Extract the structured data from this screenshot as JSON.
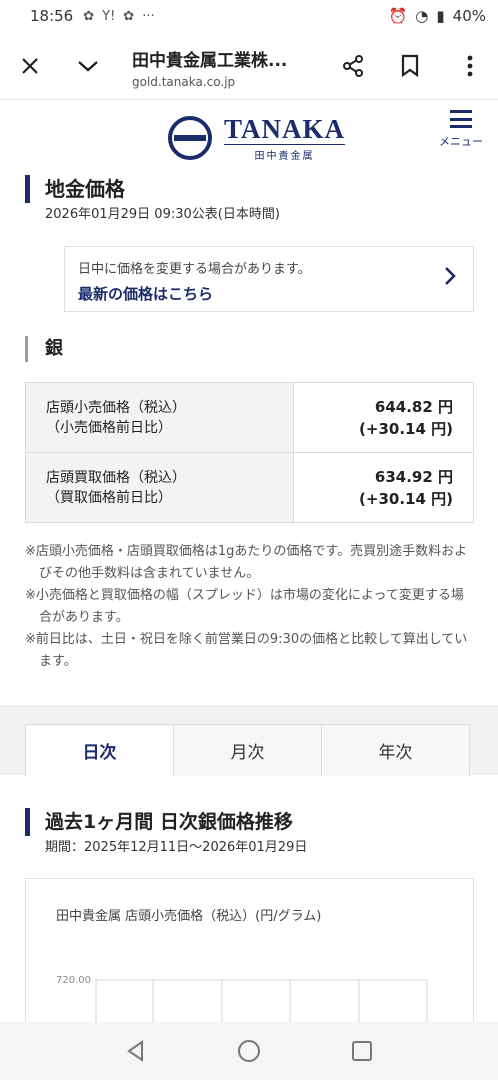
{
  "status": {
    "time": "18:56",
    "battery": "40%"
  },
  "browser": {
    "title": "田中貴金属工業株...",
    "url": "gold.tanaka.co.jp"
  },
  "site": {
    "logo_en": "TANAKA",
    "logo_jp": "田中貴金属",
    "menu_label": "メニュー"
  },
  "page": {
    "title": "地金価格",
    "published": "2026年01月29日 09:30公表(日本時間)",
    "notice": {
      "text": "日中に価格を変更する場合があります。",
      "link": "最新の価格はこちら"
    },
    "metal": "銀",
    "rows": [
      {
        "label1": "店頭小売価格（税込）",
        "label2": "（小売価格前日比）",
        "value1": "644.82 円",
        "value2": "(+30.14 円)"
      },
      {
        "label1": "店頭買取価格（税込）",
        "label2": "（買取価格前日比）",
        "value1": "634.92 円",
        "value2": "(+30.14 円)"
      }
    ],
    "notes": [
      "※店頭小売価格・店頭買取価格は1gあたりの価格です。売買別途手数料およびその他手数料は含まれていません。",
      "※小売価格と買取価格の幅（スプレッド）は市場の変化によって変更する場合があります。",
      "※前日比は、土日・祝日を除く前営業日の9:30の価格と比較して算出しています。"
    ]
  },
  "tabs": [
    "日次",
    "月次",
    "年次"
  ],
  "chart": {
    "title": "過去1ヶ月間 日次銀価格推移",
    "period": "期間：2025年12月11日〜2026年01月29日",
    "series_label": "田中貴金属 店頭小売価格（税込）(円/グラム)",
    "y_tick": "720.00"
  },
  "colors": {
    "brand": "#1a2c6b"
  }
}
